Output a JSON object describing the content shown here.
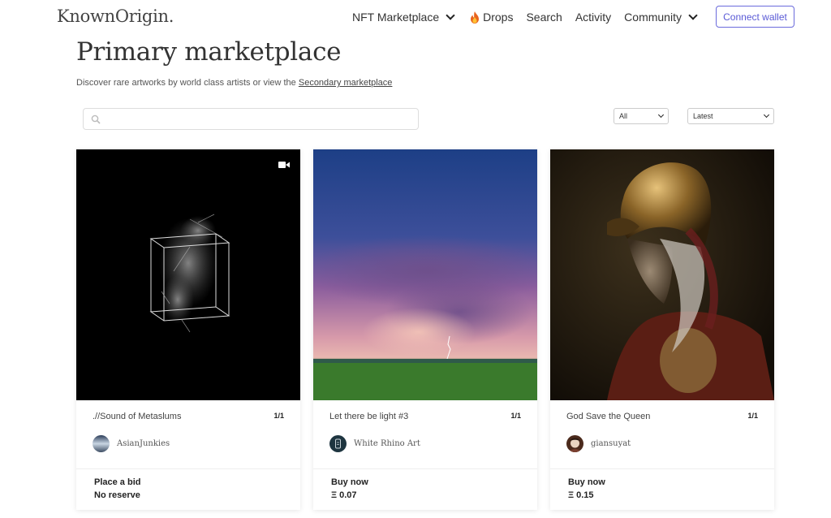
{
  "header": {
    "logo": "KnownOrigin.",
    "nav": [
      {
        "label": "NFT Marketplace",
        "has_dropdown": true
      },
      {
        "label": "Drops",
        "icon": "fire-icon"
      },
      {
        "label": "Search"
      },
      {
        "label": "Activity"
      },
      {
        "label": "Community",
        "has_dropdown": true
      }
    ],
    "connect_wallet": "Connect wallet"
  },
  "page": {
    "title": "Primary marketplace",
    "subtitle_prefix": "Discover rare artworks by world class artists or view the ",
    "subtitle_link": "Secondary marketplace"
  },
  "filters": {
    "search_placeholder": "",
    "type_select": "All",
    "sort_select": "Latest"
  },
  "cards": [
    {
      "title": ".//Sound of Metaslums",
      "edition": "1/1",
      "artist": "AsianJunkies",
      "sale_label": "Place a bid",
      "sale_value": "No reserve",
      "media_icon": "video-icon"
    },
    {
      "title": "Let there be light #3",
      "edition": "1/1",
      "artist": "White Rhino Art",
      "sale_label": "Buy now",
      "sale_value": "Ξ 0.07"
    },
    {
      "title": "God Save the Queen",
      "edition": "1/1",
      "artist": "giansuyat",
      "sale_label": "Buy now",
      "sale_value": "Ξ 0.15"
    }
  ],
  "colors": {
    "accent": "#5a5ad6",
    "text": "#222222"
  }
}
